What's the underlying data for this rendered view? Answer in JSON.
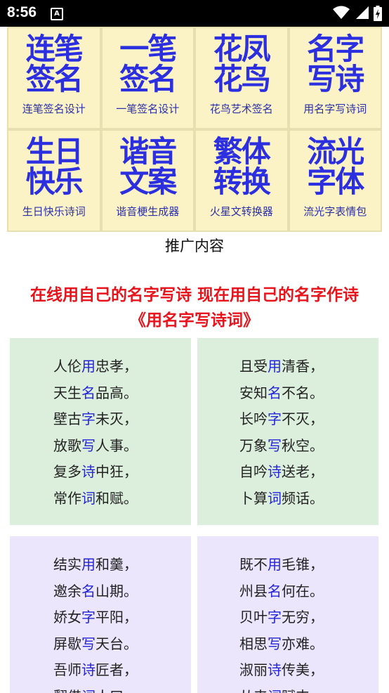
{
  "status_bar": {
    "time": "8:56",
    "notification_letter": "A"
  },
  "tiles": [
    {
      "logo": [
        "连笔",
        "签名"
      ],
      "label": "连笔签名设计"
    },
    {
      "logo": [
        "一笔",
        "签名"
      ],
      "label": "一笔签名设计"
    },
    {
      "logo": [
        "花凤",
        "花鸟"
      ],
      "label": "花鸟艺术签名"
    },
    {
      "logo": [
        "名字",
        "写诗"
      ],
      "label": "用名字写诗词"
    },
    {
      "logo": [
        "生日",
        "快乐"
      ],
      "label": "生日快乐诗词"
    },
    {
      "logo": [
        "谐音",
        "文案"
      ],
      "label": "谐音梗生成器"
    },
    {
      "logo": [
        "繁体",
        "转换"
      ],
      "label": "火星文转换器"
    },
    {
      "logo": [
        "流光",
        "字体"
      ],
      "label": "流光字表情包"
    }
  ],
  "promo_label": "推广内容",
  "headline": {
    "line1": "在线用自己的名字写诗 现在用自己的名字作诗",
    "line2": "《用名字写诗词》"
  },
  "poems": [
    {
      "lines": [
        {
          "a": "人伦",
          "h": "用",
          "b": "忠孝，"
        },
        {
          "a": "天生",
          "h": "名",
          "b": "品高。"
        },
        {
          "a": "壁古",
          "h": "字",
          "b": "未灭，"
        },
        {
          "a": "放歌",
          "h": "写",
          "b": "人事。"
        },
        {
          "a": "复多",
          "h": "诗",
          "b": "中狂，"
        },
        {
          "a": "常作",
          "h": "词",
          "b": "和赋。"
        }
      ]
    },
    {
      "lines": [
        {
          "a": "且受",
          "h": "用",
          "b": "清香，"
        },
        {
          "a": "安知",
          "h": "名",
          "b": "不名。"
        },
        {
          "a": "长吟",
          "h": "字",
          "b": "不灭，"
        },
        {
          "a": "万象",
          "h": "写",
          "b": "秋空。"
        },
        {
          "a": "自吟",
          "h": "诗",
          "b": "送老，"
        },
        {
          "a": "卜算",
          "h": "词",
          "b": "频话。"
        }
      ]
    },
    {
      "lines": [
        {
          "a": "结实",
          "h": "用",
          "b": "和羹，"
        },
        {
          "a": "邀余",
          "h": "名",
          "b": "山期。"
        },
        {
          "a": "娇女",
          "h": "字",
          "b": "平阳，"
        },
        {
          "a": "屏歇",
          "h": "写",
          "b": "天台。"
        },
        {
          "a": "吾师",
          "h": "诗",
          "b": "匠者，"
        },
        {
          "a": "翻借",
          "h": "词",
          "b": "人口。"
        }
      ]
    },
    {
      "lines": [
        {
          "a": "既不",
          "h": "用",
          "b": "毛锥，"
        },
        {
          "a": "州县",
          "h": "名",
          "b": "何在。"
        },
        {
          "a": "贝叶",
          "h": "字",
          "b": "无穷，"
        },
        {
          "a": "相思",
          "h": "写",
          "b": "亦难。"
        },
        {
          "a": "淑丽",
          "h": "诗",
          "b": "传美，"
        },
        {
          "a": "从来",
          "h": "词",
          "b": "赋丰。"
        }
      ]
    }
  ],
  "colors": {
    "tile_bg": "#fbf3c6",
    "logo": "#2b2fe0",
    "headline": "#e8141c",
    "highlight": "#2424d8"
  }
}
